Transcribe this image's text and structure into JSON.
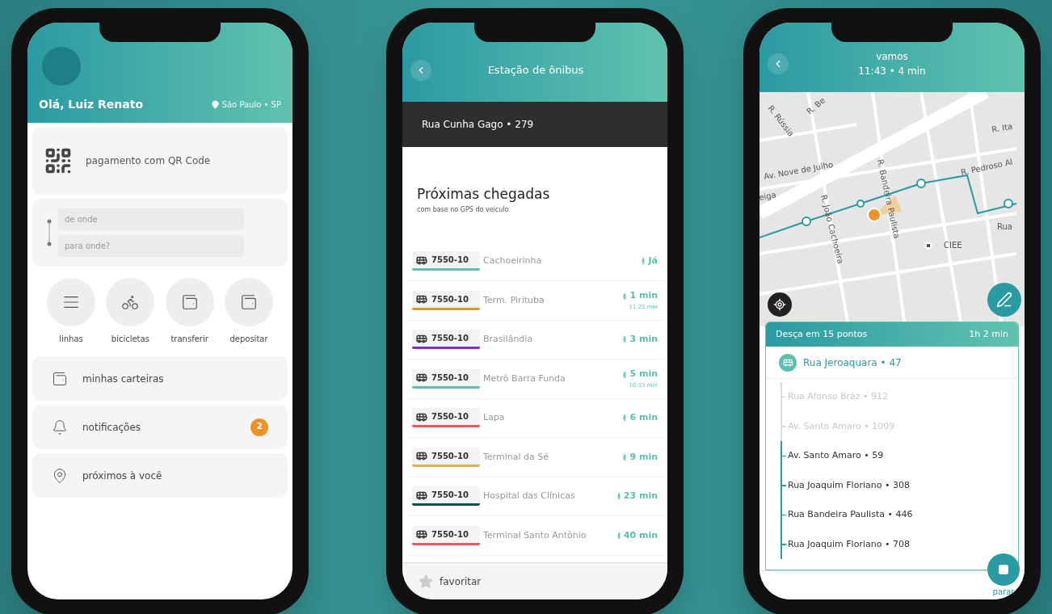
{
  "home": {
    "greeting": "Olá, Luiz Renato",
    "location": "São Paulo • SP",
    "qr_payment": "pagamento com QR Code",
    "route_fields": [
      {
        "placeholder": "de onde"
      },
      {
        "placeholder": "para onde?"
      }
    ],
    "actions": [
      {
        "label": "linhas"
      },
      {
        "label": "bicicletas"
      },
      {
        "label": "transferir"
      },
      {
        "label": "depositar"
      }
    ],
    "menu": [
      {
        "label": "minhas carteiras"
      },
      {
        "label": "notificações",
        "badge": "2"
      },
      {
        "label": "próximos à você"
      }
    ]
  },
  "station": {
    "title": "Estação de ônibus",
    "stop": "Rua Cunha Gago • 279",
    "heading": "Próximas chegadas",
    "subheading": "com base no GPS do veículo",
    "arrivals": [
      {
        "line": "7550-10",
        "destination": "Cachoeirinha",
        "eta": "Já",
        "color": "#5bbfae"
      },
      {
        "line": "7550-10",
        "destination": "Term. Pirituba",
        "eta": "1 min",
        "scheduled": "11:25 min",
        "color": "#e8922a"
      },
      {
        "line": "7550-10",
        "destination": "Brasilândia",
        "eta": "3 min",
        "color": "#7b2fd6"
      },
      {
        "line": "7550-10",
        "destination": "Metrô Barra Funda",
        "eta": "5 min",
        "scheduled": "10:15 min",
        "color": "#5bbfae"
      },
      {
        "line": "7550-10",
        "destination": "Lapa",
        "eta": "6 min",
        "color": "#e85a5a"
      },
      {
        "line": "7550-10",
        "destination": "Terminal da Sé",
        "eta": "9 min",
        "color": "#e8b04a"
      },
      {
        "line": "7550-10",
        "destination": "Hospital das Clínicas",
        "eta": "23 min",
        "color": "#0f4f50"
      },
      {
        "line": "7550-10",
        "destination": "Terminal Santo Antônio",
        "eta": "40 min",
        "color": "#e85a5a"
      }
    ],
    "favorite": "favoritar"
  },
  "trip": {
    "title": "vamos",
    "subtitle": "11:43 • 4 min",
    "map_labels": [
      "R. Rússia",
      "R. Be",
      "Av. Nove de Julho",
      "R. João Cachoeira",
      "R. Bandeira Paulista",
      "R. Pedroso Al",
      "R. Ita",
      "eiga",
      "Rua",
      "CIEE"
    ],
    "panel_title": "Desça em 15 pontos",
    "duration": "1h 2 min",
    "origin": "Rua Jeroaquara • 47",
    "stops": [
      {
        "name": "Rua Afonso Bráz • 912",
        "passed": true
      },
      {
        "name": "Av. Santo Amaro • 1009",
        "passed": true
      },
      {
        "name": "Av. Santo Amaro • 59",
        "passed": false
      },
      {
        "name": "Rua Joaquim Floriano • 308",
        "passed": false
      },
      {
        "name": "Rua Bandeira Paulista • 446",
        "passed": false
      },
      {
        "name": "Rua Joaquim Floriano • 708",
        "passed": false
      }
    ],
    "stop_button": "parar"
  }
}
